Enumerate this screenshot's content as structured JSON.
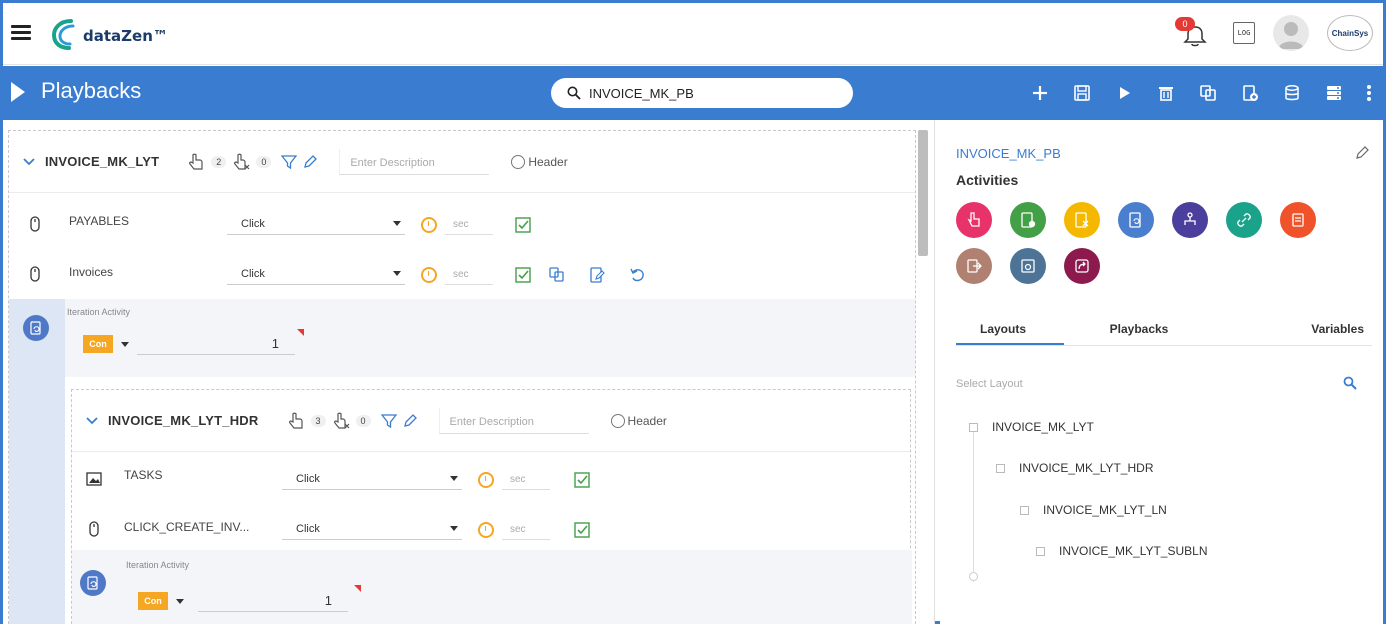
{
  "app": {
    "brand": "dataZen™",
    "partner_logo": "ChainSys",
    "notification_count": "0",
    "log_label": "LOG"
  },
  "titlebar": {
    "title": "Playbacks",
    "search_value": "INVOICE_MK_PB",
    "actions": [
      "add-icon",
      "save-icon",
      "play-icon",
      "delete-icon",
      "copy-icon",
      "import-icon",
      "database-icon",
      "server-icon",
      "more-icon"
    ]
  },
  "layouts": [
    {
      "name": "INVOICE_MK_LYT",
      "count_a": "2",
      "count_b": "0",
      "desc_placeholder": "Enter Description",
      "header_label": "Header",
      "activities": [
        {
          "name": "PAYABLES",
          "event": "Click",
          "sec": "sec"
        },
        {
          "name": "Invoices",
          "event": "Click",
          "sec": "sec"
        }
      ],
      "iteration": {
        "label": "Iteration Activity",
        "con": "Con",
        "value": "1"
      }
    },
    {
      "name": "INVOICE_MK_LYT_HDR",
      "count_a": "3",
      "count_b": "0",
      "desc_placeholder": "Enter Description",
      "header_label": "Header",
      "activities": [
        {
          "name": "TASKS",
          "event": "Click",
          "sec": "sec"
        },
        {
          "name": "CLICK_CREATE_INV...",
          "event": "Click",
          "sec": "sec"
        }
      ],
      "iteration": {
        "label": "Iteration Activity",
        "con": "Con",
        "value": "1"
      }
    }
  ],
  "right": {
    "playback_name": "INVOICE_MK_PB",
    "activities_title": "Activities",
    "activity_colors": [
      "#e8336a",
      "#43a047",
      "#f5b800",
      "#4a7fd0",
      "#4b3f9e",
      "#1aa38a",
      "#f0522a",
      "#b08070",
      "#4d7497",
      "#8c1a4f"
    ],
    "tabs": [
      "Layouts",
      "Playbacks",
      "Variables"
    ],
    "select_layout_placeholder": "Select Layout",
    "tree": [
      "INVOICE_MK_LYT",
      "INVOICE_MK_LYT_HDR",
      "INVOICE_MK_LYT_LN",
      "INVOICE_MK_LYT_SUBLN"
    ]
  },
  "colors": {
    "accent": "#3a7dd0",
    "clock": "#f5a623",
    "check": "#43a047",
    "con": "#f5a623"
  }
}
